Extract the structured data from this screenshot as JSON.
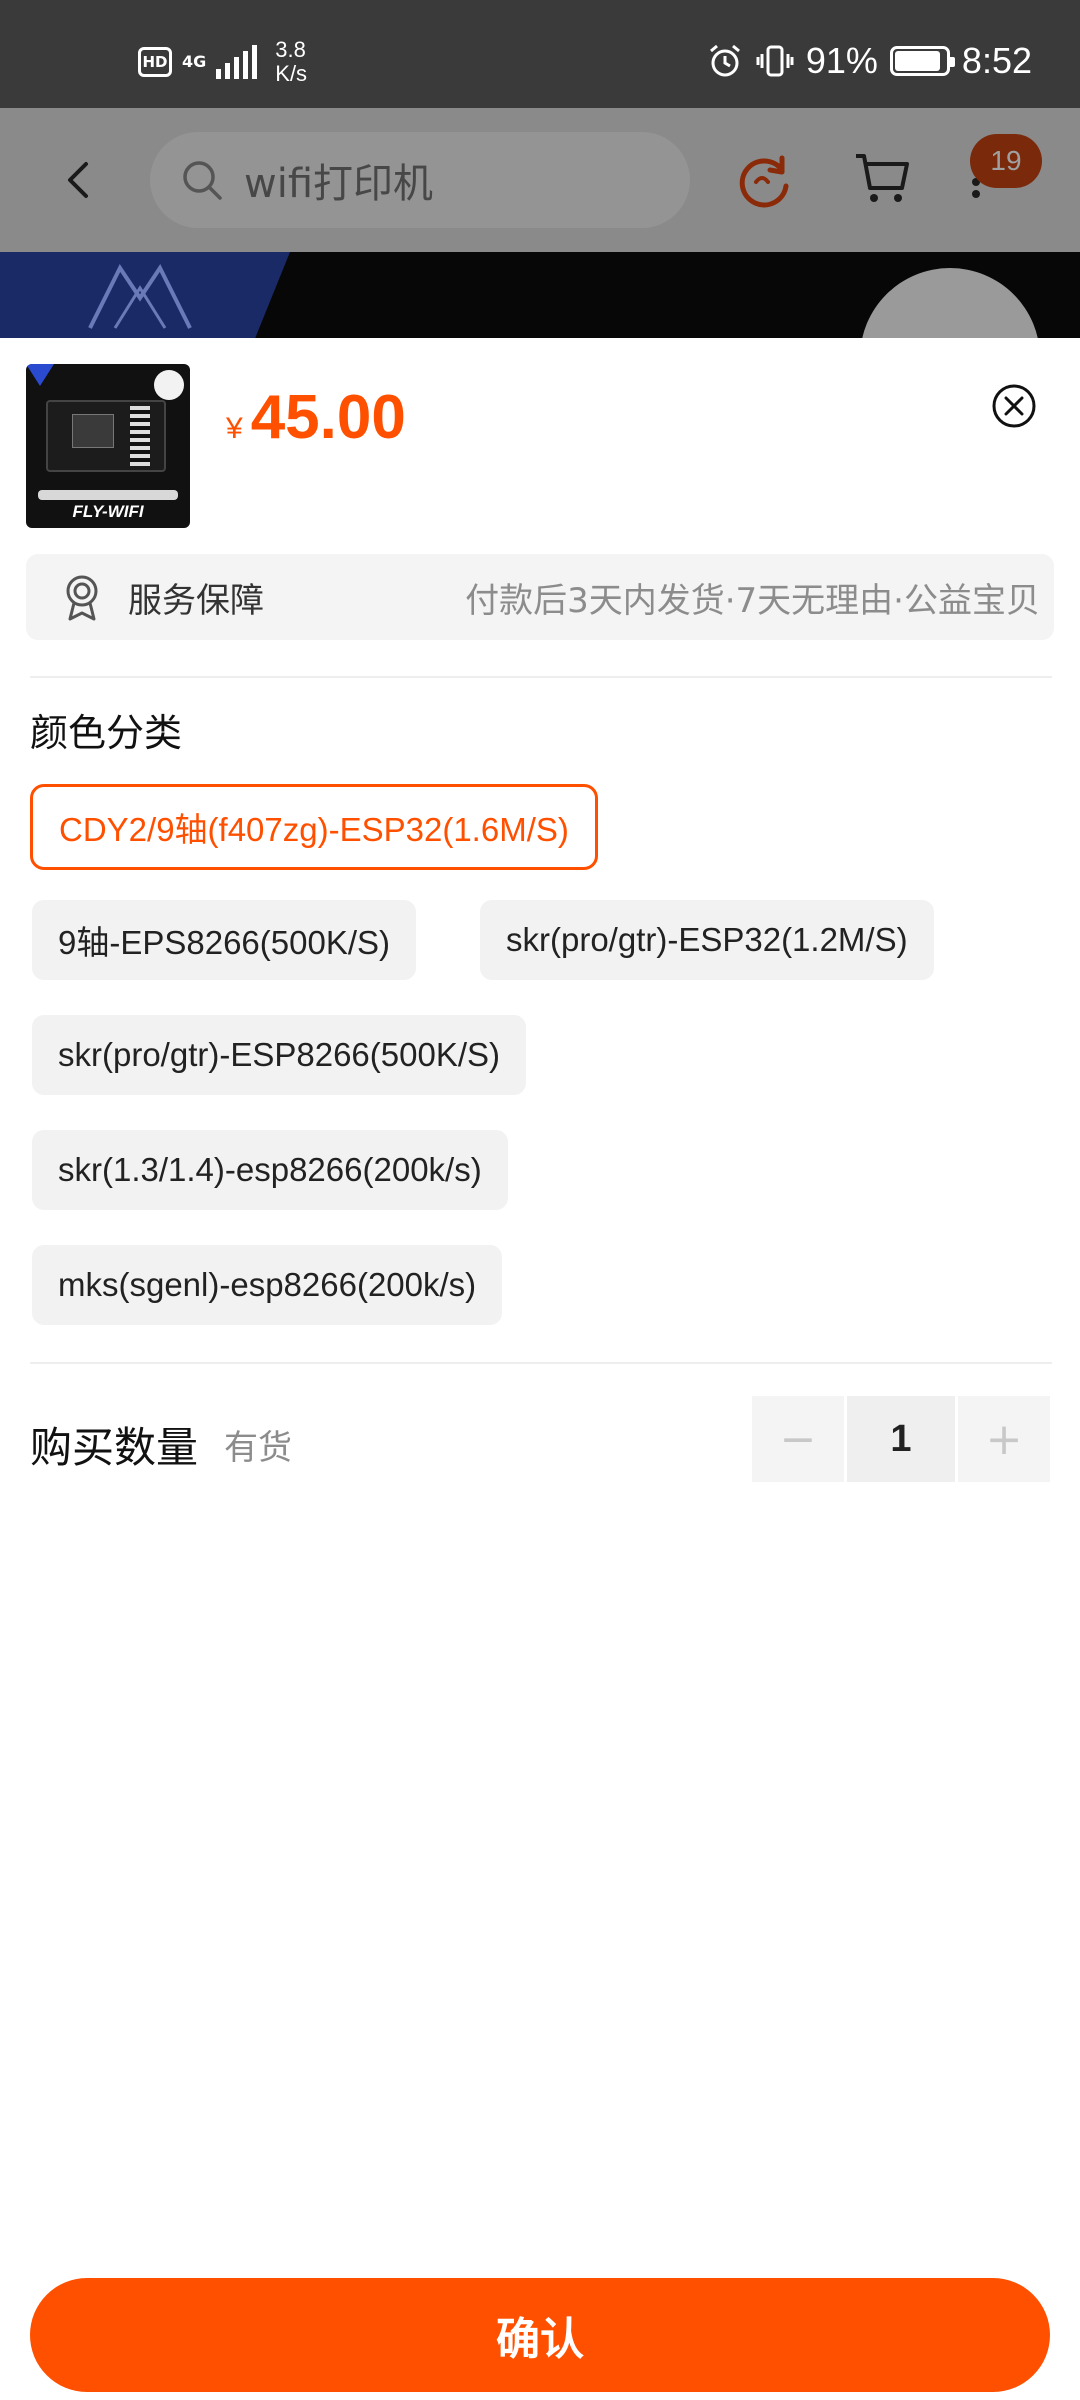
{
  "status_bar": {
    "hd": "HD",
    "network": "4G",
    "speed_value": "3.8",
    "speed_unit": "K/s",
    "battery_percent": "91%",
    "battery_level": 0.91,
    "time": "8:52"
  },
  "nav": {
    "search_placeholder": "wifi打印机",
    "cart_badge": "19"
  },
  "product": {
    "thumbnail_label": "FLY-WIFI",
    "currency": "¥",
    "price": "45.00"
  },
  "service": {
    "title": "服务保障",
    "detail": "付款后3天内发货·7天无理由·公益宝贝"
  },
  "variants": {
    "title": "颜色分类",
    "options": [
      "CDY2/9轴(f407zg)-ESP32(1.6M/S)",
      "9轴-EPS8266(500K/S)",
      "skr(pro/gtr)-ESP32(1.2M/S)",
      "skr(pro/gtr)-ESP8266(500K/S)",
      "skr(1.3/1.4)-esp8266(200k/s)",
      "mks(sgenl)-esp8266(200k/s)"
    ],
    "selected_index": 0
  },
  "quantity": {
    "label": "购买数量",
    "stock": "有货",
    "value": "1",
    "minus": "−",
    "plus": "+"
  },
  "confirm_label": "确认",
  "colors": {
    "accent": "#ff5000",
    "status_bar": "#3a3a3a",
    "overlay_nav": "#8a8a8a"
  }
}
